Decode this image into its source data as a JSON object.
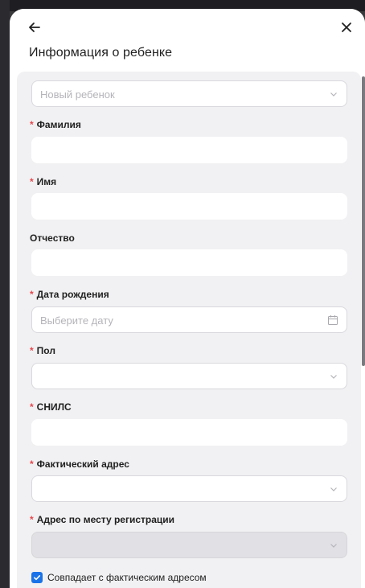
{
  "header": {
    "title": "Информация о ребенке"
  },
  "child_select": {
    "placeholder": "Новый ребенок"
  },
  "fields": {
    "last_name": {
      "label": "Фамилия",
      "required": true
    },
    "first_name": {
      "label": "Имя",
      "required": true
    },
    "patronymic": {
      "label": "Отчество",
      "required": false
    },
    "birth_date": {
      "label": "Дата рождения",
      "required": true,
      "placeholder": "Выберите дату"
    },
    "gender": {
      "label": "Пол",
      "required": true
    },
    "snils": {
      "label": "СНИЛС",
      "required": true
    },
    "actual_address": {
      "label": "Фактический адрес",
      "required": true
    },
    "registration_address": {
      "label": "Адрес по месту регистрации",
      "required": true
    }
  },
  "same_address_checkbox": {
    "label": "Совпадает с фактическим адресом",
    "checked": true
  },
  "required_marker": "*",
  "colors": {
    "accent": "#1a73e8",
    "required": "#e5484d",
    "panel": "#f1f1f3"
  },
  "icons": [
    "arrow-left-icon",
    "close-icon",
    "chevron-down-icon",
    "calendar-icon",
    "checkmark-icon"
  ]
}
